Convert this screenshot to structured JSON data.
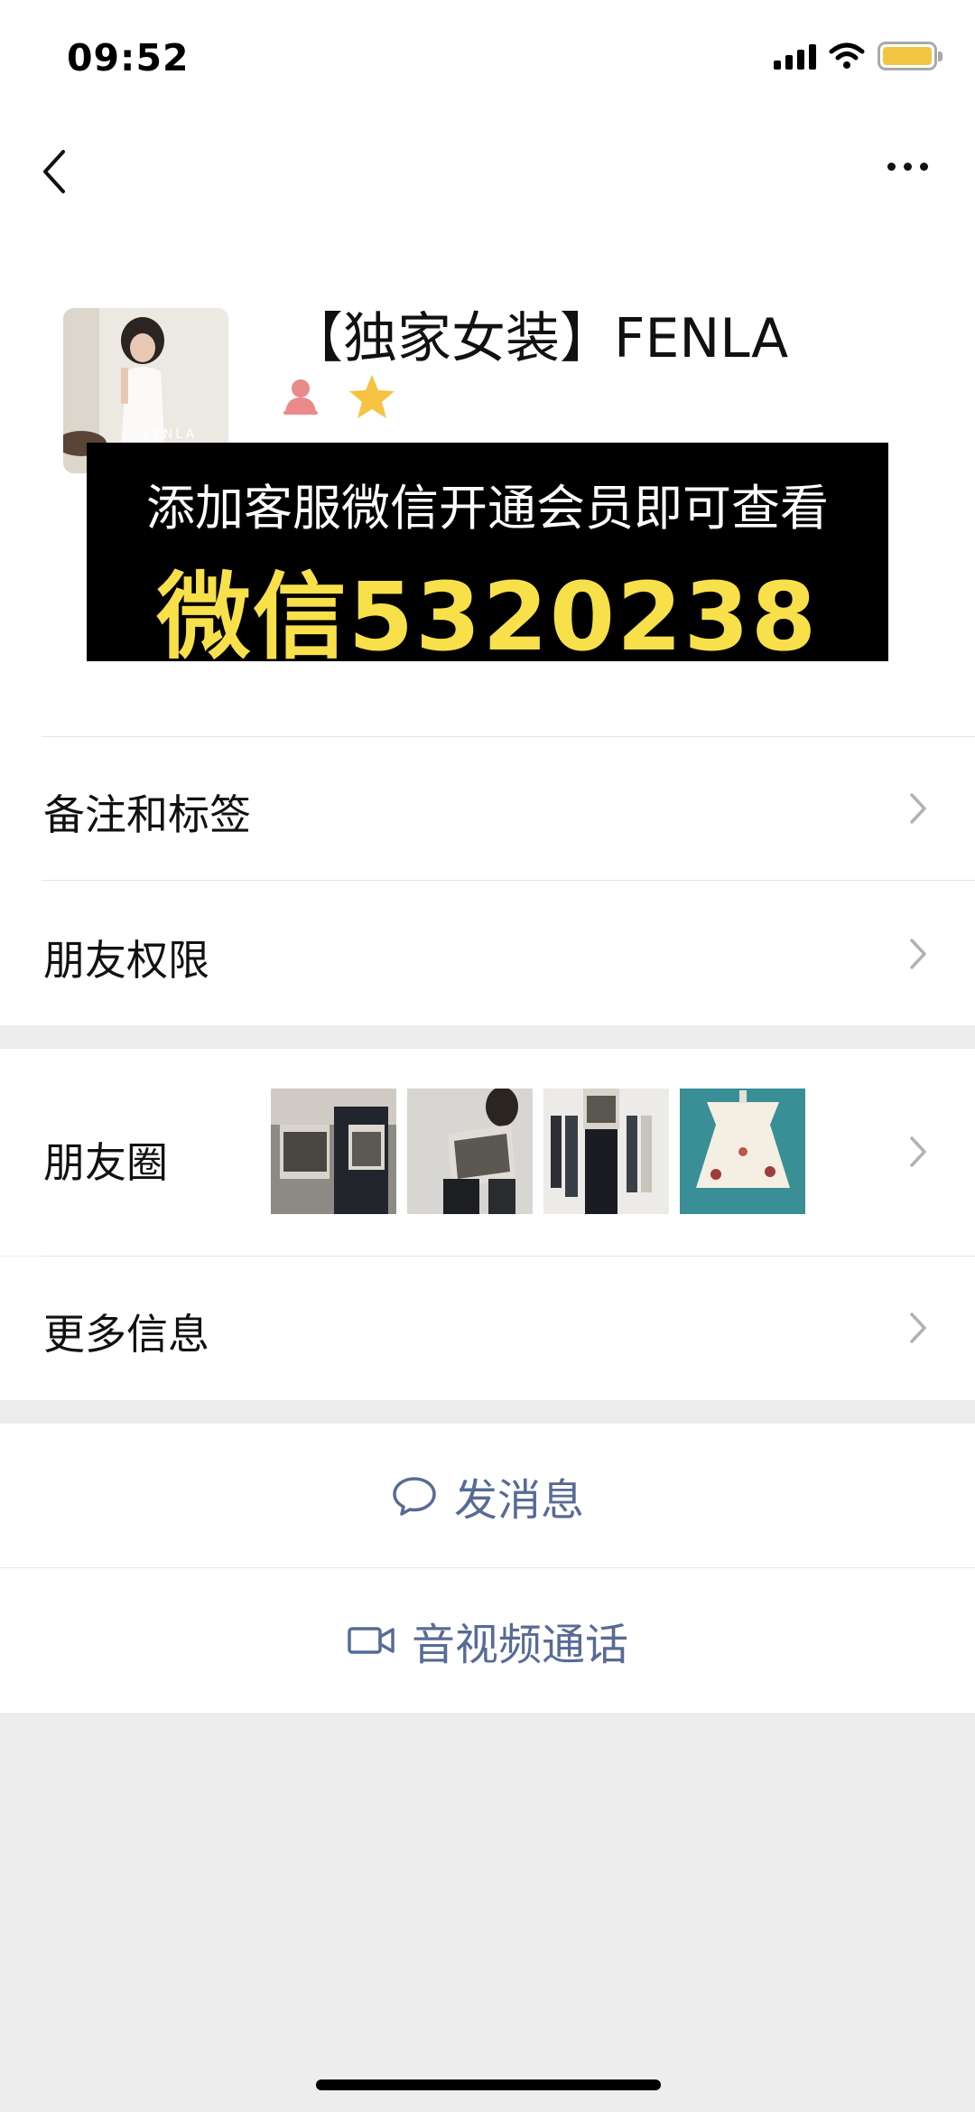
{
  "status_bar": {
    "time": "09:52"
  },
  "profile": {
    "name": "【独家女装】FENLA",
    "avatar_text": "FENLA"
  },
  "banner": {
    "line1": "添加客服微信开通会员即可查看",
    "line2": "微信5320238"
  },
  "menu": {
    "remarks_label": "备注和标签",
    "permissions_label": "朋友权限",
    "moments_label": "朋友圈",
    "more_info_label": "更多信息"
  },
  "actions": {
    "message_label": "发消息",
    "call_label": "音视频通话"
  },
  "colors": {
    "link_blue": "#576b95",
    "banner_yellow": "#f7e04a",
    "star_yellow": "#f6c342",
    "gender_pink": "#ea8a8a",
    "background": "#ededed"
  },
  "icons": [
    "back-icon",
    "more-icon",
    "gender-female-icon",
    "star-icon",
    "chevron-right-icon",
    "chat-bubble-icon",
    "video-camera-icon"
  ]
}
